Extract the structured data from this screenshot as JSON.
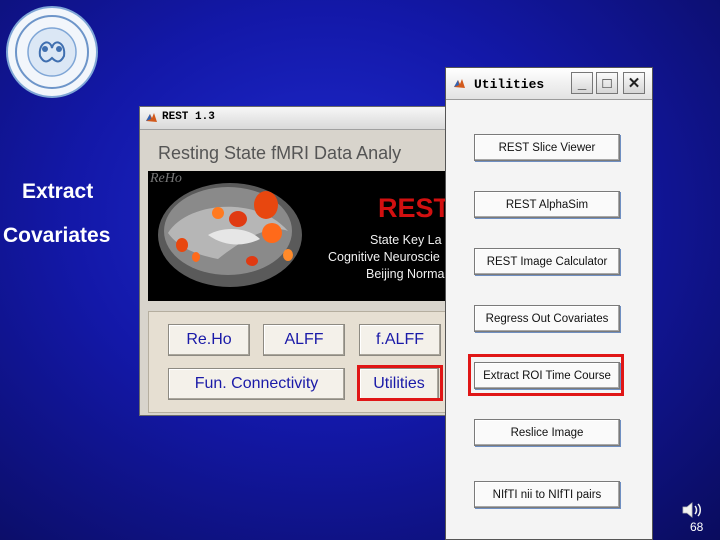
{
  "slide": {
    "label_line1": "Extract",
    "label_line2": "Covariates",
    "page_number": "68"
  },
  "logo": {
    "icon": "university-logo-icon"
  },
  "rest_window": {
    "title": "REST 1.3",
    "heading": "Resting State fMRI Data Analy",
    "brain_caption": "ReHo",
    "product_word": "REST",
    "institution_lines": [
      "State Key La",
      "Cognitive Neuroscie",
      "Beijing Norma"
    ],
    "buttons": {
      "reho": "Re.Ho",
      "alff": "ALFF",
      "falff": "f.ALFF",
      "fun_connectivity": "Fun. Connectivity",
      "utilities": "Utilities"
    }
  },
  "utilities_window": {
    "title": "Utilities",
    "controls": {
      "minimize": "_",
      "maximize": "□",
      "close": "✕"
    },
    "buttons": [
      "REST Slice Viewer",
      "REST AlphaSim",
      "REST Image Calculator",
      "Regress Out Covariates",
      "Extract ROI Time Course",
      "Reslice Image",
      "NIfTI nii to NIfTI pairs"
    ]
  },
  "colors": {
    "highlight": "#e01616",
    "button_text": "#1a1aa8",
    "background": "#1318a8"
  }
}
